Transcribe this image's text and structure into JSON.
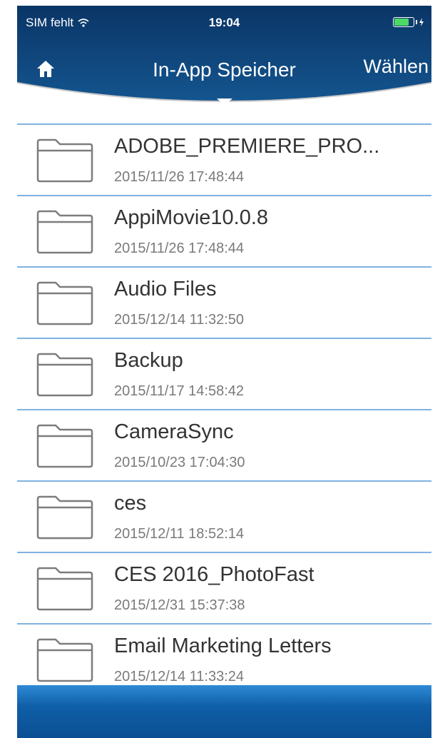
{
  "status_bar": {
    "carrier": "SIM fehlt",
    "time": "19:04"
  },
  "nav": {
    "title": "In-App Speicher",
    "select_label": "Wählen"
  },
  "files": [
    {
      "name": "ADOBE_PREMIERE_PRO...",
      "date": "2015/11/26 17:48:44"
    },
    {
      "name": "AppiMovie10.0.8",
      "date": "2015/11/26 17:48:44"
    },
    {
      "name": "Audio Files",
      "date": "2015/12/14 11:32:50"
    },
    {
      "name": "Backup",
      "date": "2015/11/17 14:58:42"
    },
    {
      "name": "CameraSync",
      "date": "2015/10/23 17:04:30"
    },
    {
      "name": "ces",
      "date": "2015/12/11 18:52:14"
    },
    {
      "name": "CES 2016_PhotoFast",
      "date": "2015/12/31 15:37:38"
    },
    {
      "name": "Email Marketing Letters",
      "date": "2015/12/14 11:33:24"
    }
  ],
  "colors": {
    "header_blue": "#0b3f73",
    "separator": "#7fb2e0",
    "bottom_bar": "#1a6fc0"
  }
}
